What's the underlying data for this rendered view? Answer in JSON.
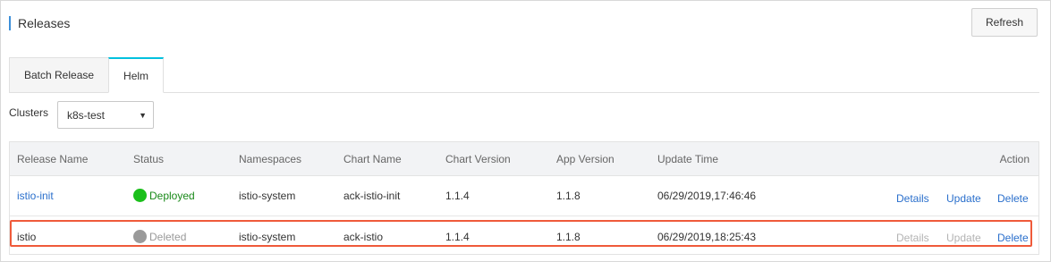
{
  "header": {
    "title": "Releases",
    "refresh_label": "Refresh"
  },
  "tabs": [
    {
      "label": "Batch Release",
      "active": false
    },
    {
      "label": "Helm",
      "active": true
    }
  ],
  "cluster": {
    "label": "Clusters",
    "selected": "k8s-test"
  },
  "table": {
    "columns": [
      "Release Name",
      "Status",
      "Namespaces",
      "Chart Name",
      "Chart Version",
      "App Version",
      "Update Time",
      "Action"
    ],
    "rows": [
      {
        "release_name": "istio-init",
        "status": "Deployed",
        "namespace": "istio-system",
        "chart_name": "ack-istio-init",
        "chart_version": "1.1.4",
        "app_version": "1.1.8",
        "update_time": "06/29/2019,17:46:46",
        "actions": {
          "details": "Details",
          "update": "Update",
          "delete": "Delete"
        }
      },
      {
        "release_name": "istio",
        "status": "Deleted",
        "namespace": "istio-system",
        "chart_name": "ack-istio",
        "chart_version": "1.1.4",
        "app_version": "1.1.8",
        "update_time": "06/29/2019,18:25:43",
        "actions": {
          "details": "Details",
          "update": "Update",
          "delete": "Delete"
        }
      }
    ]
  },
  "colors": {
    "accent": "#00c1de",
    "link": "#2a6fcc",
    "deployed": "#1bbf1b",
    "deleted": "#9a9a9a",
    "highlight": "#ef5a3a"
  }
}
